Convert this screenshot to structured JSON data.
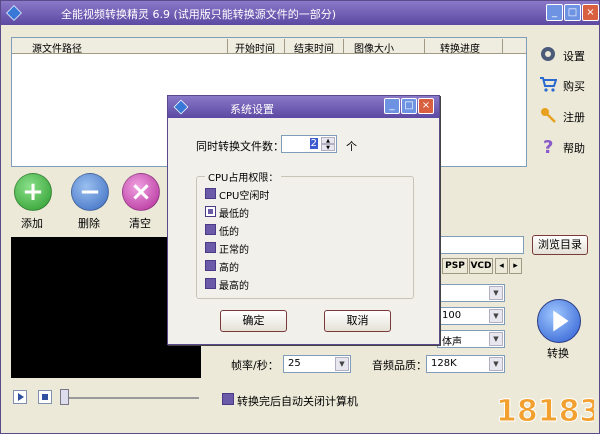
{
  "window": {
    "title": "全能视频转换精灵 6.9 (试用版只能转换源文件的一部分)"
  },
  "titlebar": {
    "min": "_",
    "max": "□",
    "close": "×"
  },
  "list": {
    "columns": [
      "源文件路径",
      "开始时间",
      "结束时间",
      "图像大小",
      "转换进度"
    ]
  },
  "side": [
    {
      "label": "设置",
      "icon": "gear-icon"
    },
    {
      "label": "购买",
      "icon": "cart-icon"
    },
    {
      "label": "注册",
      "icon": "key-icon"
    },
    {
      "label": "帮助",
      "icon": "help-icon"
    }
  ],
  "actions": {
    "add": "添加",
    "remove": "删除",
    "clear": "清空",
    "add_glyph": "+",
    "remove_glyph": "−",
    "clear_glyph": "×"
  },
  "output": {
    "browse": "浏览目录",
    "tabs": [
      "PSP",
      "VCD"
    ]
  },
  "settings": {
    "field2_value": "100",
    "field3_value": "体声",
    "fps_label": "帧率/秒：",
    "fps_value": "25",
    "audio_quality_label": "音频品质：",
    "audio_quality_value": "128K"
  },
  "convert": {
    "label": "转换"
  },
  "shutdown": {
    "label": "转换完后自动关闭计算机"
  },
  "dialog": {
    "title": "系统设置",
    "concurrent_label": "同时转换文件数：",
    "concurrent_value": "2",
    "concurrent_unit": "个",
    "cpu_group": "CPU占用权限：",
    "options": [
      "CPU空闲时",
      "最低的",
      "低的",
      "正常的",
      "高的",
      "最高的"
    ],
    "selected_option": 1,
    "ok": "确定",
    "cancel": "取消"
  },
  "watermark": {
    "text": "18183"
  },
  "colors": {
    "titlebar": "#5b49a3",
    "add": "#3aa83a",
    "remove": "#4a7ac8",
    "clear": "#c83aa8",
    "convert": "#3a6ad8"
  }
}
